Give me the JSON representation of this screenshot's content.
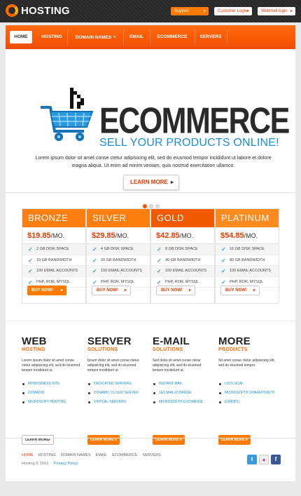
{
  "header": {
    "logo_text": "HOSTING",
    "support": "Support",
    "customer_login": "Customer Login",
    "webmail_login": "Webmail login"
  },
  "nav": {
    "items": [
      "HOME",
      "HOSTING",
      "DOMAIN NAMES",
      "EMAIL",
      "ECOMMERCE",
      "SERVERS"
    ]
  },
  "hero": {
    "title": "ECOMMERCE",
    "subtitle": "SELL YOUR PRODUCTS ONLINE!",
    "text": "Lorem ipsum dolor sit amet conse ctetur adipisicing elit, sed do eiusmod tempor incididunt ut labore et dolore magna aliqua. Ut enim ad minim veniam, quis nostrud exercitation ullamco.",
    "button": "LEARN MORE",
    "active_slide": 1,
    "slide_count": 3
  },
  "pricing": {
    "buy_label": "BUY NOW!",
    "plans": [
      {
        "name": "BRONZE",
        "price": "$19.85",
        "per": "/MO.",
        "color": "#ff7e10",
        "features": [
          "2 GB DISK SPACE",
          "10 GB BANDWIDTH",
          "100 EMAIL ACCOUNTS",
          "PHP, ROR, MYSQL"
        ]
      },
      {
        "name": "SILVER",
        "price": "$29.85",
        "per": "/MO.",
        "color": "#ff7e10",
        "features": [
          "4 GB DISK SPACE",
          "20 GB BANDWIDTH",
          "100 EMAIL ACCOUNTS",
          "PHP, ROR, MYSQL"
        ]
      },
      {
        "name": "GOLD",
        "price": "$42.85",
        "per": "/MO.",
        "color": "#f25a00",
        "features": [
          "8 GB DISK SPACE",
          "40 GB BANDWIDTH",
          "100 EMAIL ACCOUNTS",
          "PHP, ROR, MYSQL"
        ]
      },
      {
        "name": "PLATINUM",
        "price": "$54.85",
        "per": "/MO.",
        "color": "#ff8a1e",
        "features": [
          "16 GB DISK SPACE",
          "80 GB BANDWIDTH",
          "100 EMAIL ACCOUNTS",
          "PHP, ROR, MYSQL"
        ]
      }
    ]
  },
  "features": {
    "button": "LEARN MORE",
    "columns": [
      {
        "title": "WEB",
        "subtitle": "HOSTING",
        "text": "Lorem ipsum dolor sit amet conse ctetur adipisicing elit, sed do eiusmod tempor incididunt ut.",
        "items": [
          "MYBUSINESS SITE",
          "DOMAINS",
          "MICROSOFT HOSTING"
        ]
      },
      {
        "title": "SERVER",
        "subtitle": "SOLUTIONS",
        "text": "Ipsum dolor sit amet conse ctetur adipisicing elit, sed do eiusmod tempor incididunt ut.",
        "items": [
          "DEDICATED SERVERS",
          "DYNAMIC CLOUD SERVER",
          "VIRTUAL SERVERS"
        ]
      },
      {
        "title": "E-MAIL",
        "subtitle": "SOLUTIONS",
        "text": "Sed dolor sit amet conse ctetur adipisicing elit, sed do eiusmod tempor incididunt ut.",
        "items": [
          "INSTANT MAIL",
          "1&1 MAILXCHANGE",
          "MICROSOFT® EXCHANGE"
        ]
      },
      {
        "title": "MORE",
        "subtitle": "PRODUCTS",
        "text": "Sit amet conse ctetur adipisicing elit, sed do eiusmod tempor.",
        "items": [
          "LISTLOCAL",
          "MICROSOFT® SHAREPOINT®",
          "ESHOPS"
        ]
      }
    ]
  },
  "footer": {
    "links": [
      "HOME",
      "HOSTING",
      "DOMAIN NAMES",
      "EMAIL",
      "ECOMMERCE",
      "SERVERS"
    ],
    "copyright": "Hosting © 2013",
    "privacy": "Privacy Policy",
    "social": [
      "twitter-icon",
      "flickr-icon",
      "facebook-icon"
    ]
  }
}
